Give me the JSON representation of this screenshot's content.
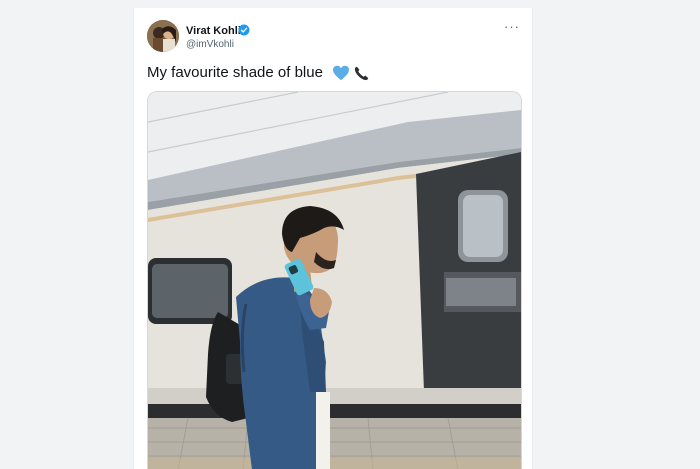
{
  "tweet": {
    "author_name": "Virat Kohli",
    "author_handle": "@imVkohli",
    "text": "My favourite shade of blue",
    "more_label": "···"
  },
  "icons": {
    "verified": "verified-badge-icon",
    "heart": "blue-heart-emoji",
    "phone": "telephone-receiver-emoji",
    "more": "more-options-icon"
  },
  "colors": {
    "verified": "#1d9bf0",
    "blue_heart": "#5aaee8",
    "page_bg": "#f2f3f4"
  }
}
